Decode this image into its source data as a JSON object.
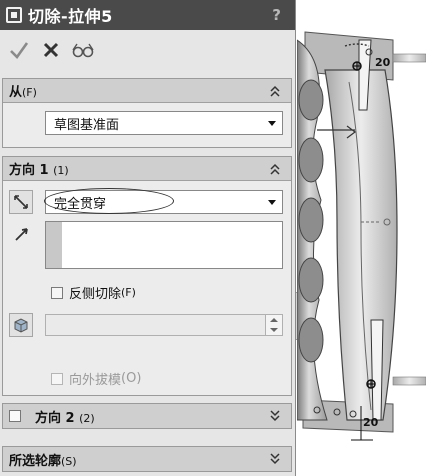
{
  "window": {
    "title": "切除-拉伸5",
    "help": "?"
  },
  "actions": {
    "ok": "ok-icon",
    "cancel": "cancel-icon",
    "preview": "preview-icon"
  },
  "from_group": {
    "title": "从",
    "shortcut": "(F)",
    "option": "草图基准面"
  },
  "direction1": {
    "title": "方向 1",
    "shortcut": "(1)",
    "end_condition": "完全贯穿",
    "flip_side_label": "反侧切除",
    "flip_side_shortcut": "(F)",
    "draft_label": "向外拔模",
    "draft_shortcut": "(O)"
  },
  "direction2": {
    "title": "方向 2",
    "shortcut": "(2)"
  },
  "contours": {
    "title": "所选轮廓",
    "shortcut": "(S)"
  },
  "model": {
    "dim_top": "20",
    "dim_bottom": "20"
  },
  "colors": {
    "titlebar": "#4a4a4a",
    "panel": "#e6e6e6",
    "header": "#cfcfcf"
  }
}
